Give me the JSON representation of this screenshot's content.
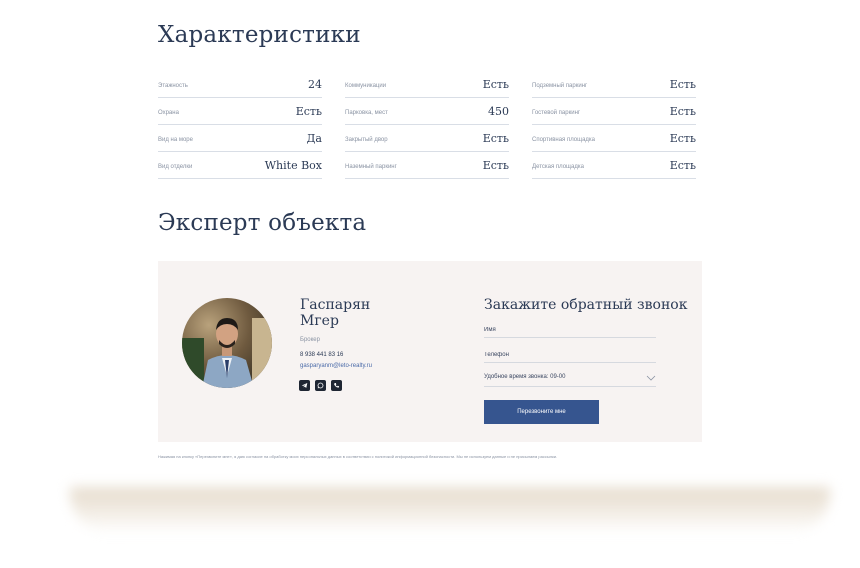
{
  "characteristics": {
    "title": "Характеристики",
    "columns": [
      [
        {
          "label": "Этажность",
          "value": "24"
        },
        {
          "label": "Охрана",
          "value": "Есть"
        },
        {
          "label": "Вид на море",
          "value": "Да"
        },
        {
          "label": "Вид отделки",
          "value": "White Box"
        }
      ],
      [
        {
          "label": "Коммуникации",
          "value": "Есть"
        },
        {
          "label": "Парковка, мест",
          "value": "450"
        },
        {
          "label": "Закрытый двор",
          "value": "Есть"
        },
        {
          "label": "Наземный паркинг",
          "value": "Есть"
        }
      ],
      [
        {
          "label": "Подземный паркинг",
          "value": "Есть"
        },
        {
          "label": "Гостевой паркинг",
          "value": "Есть"
        },
        {
          "label": "Спортивная площадка",
          "value": "Есть"
        },
        {
          "label": "Детская площадка",
          "value": "Есть"
        }
      ]
    ]
  },
  "expert": {
    "title": "Эксперт объекта",
    "name_line1": "Гаспарян",
    "name_line2": "Мгер",
    "role": "Брокер",
    "phone": "8 938 441 83 16",
    "email": "gasparyanm@leto-realty.ru",
    "socials": [
      "telegram-icon",
      "whatsapp-icon",
      "viber-icon"
    ]
  },
  "callback_form": {
    "title": "Закажите обратный звонок",
    "name_placeholder": "Имя",
    "phone_placeholder": "Телефон",
    "time_value": "Удобное время звонка: 09-00",
    "submit_label": "Перезвоните мне"
  },
  "disclaimer": "Нажимая на кнопку «Перезвоните мне», я даю согласие на обработку моих персональных данных в соответствии с политикой информационной безопасности. Мы не используем данные и не присылаем рассылки.",
  "colors": {
    "accent": "#36558f",
    "title": "#2b3a55",
    "card_bg": "#f7f3f2"
  }
}
